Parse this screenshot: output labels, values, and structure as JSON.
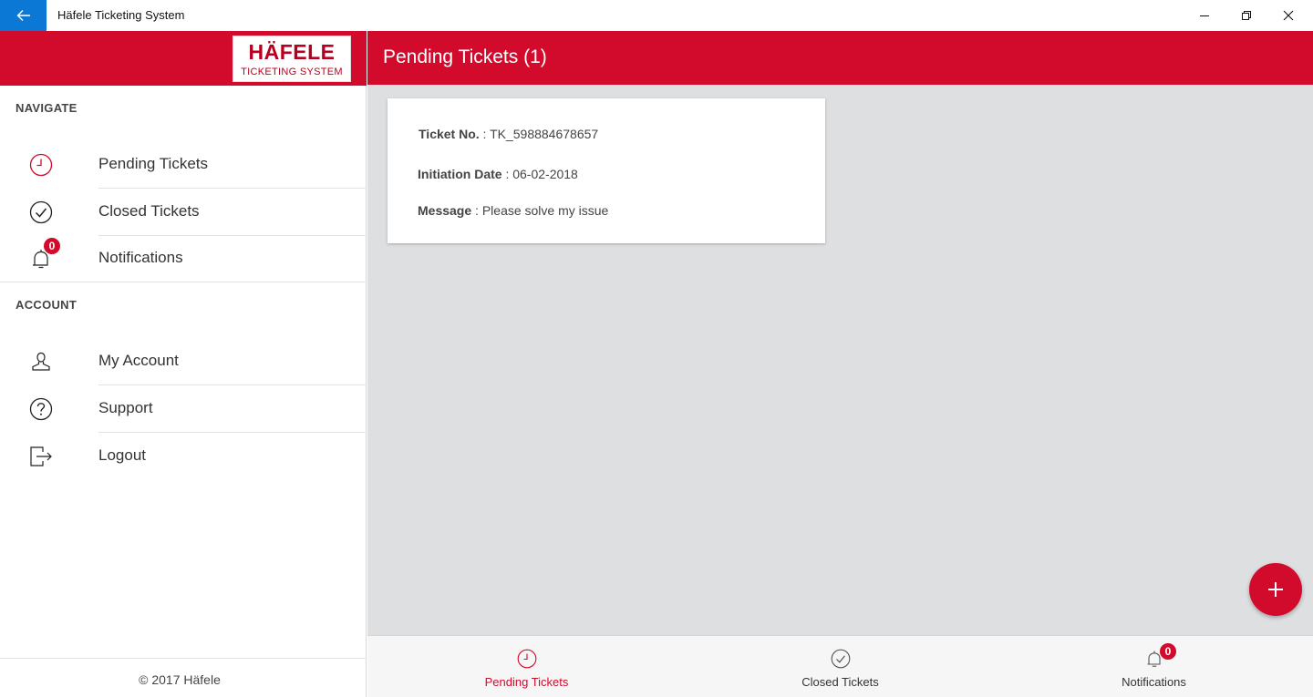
{
  "window": {
    "title": "Häfele Ticketing System"
  },
  "brand": {
    "logo_main": "HÄFELE",
    "logo_sub": "TICKETING SYSTEM",
    "accent_color": "#d20a2c"
  },
  "sidebar": {
    "navigate_heading": "NAVIGATE",
    "navigate_items": [
      {
        "label": "Pending Tickets",
        "icon": "clock-icon",
        "active": true
      },
      {
        "label": "Closed Tickets",
        "icon": "check-circle-icon"
      },
      {
        "label": "Notifications",
        "icon": "bell-icon",
        "badge": "0"
      }
    ],
    "account_heading": "ACCOUNT",
    "account_items": [
      {
        "label": "My Account",
        "icon": "user-icon"
      },
      {
        "label": "Support",
        "icon": "question-circle-icon"
      },
      {
        "label": "Logout",
        "icon": "logout-icon"
      }
    ],
    "copyright": "© 2017 Häfele"
  },
  "main": {
    "title": "Pending Tickets (1)",
    "tickets": [
      {
        "ticket_no_label": "Ticket No.",
        "ticket_no": "TK_598884678657",
        "date_label": "Initiation Date",
        "date": "06-02-2018",
        "message_label": "Message",
        "message": "Please solve my issue"
      }
    ]
  },
  "tabbar": {
    "tabs": [
      {
        "label": "Pending Tickets",
        "icon": "clock-icon",
        "active": true
      },
      {
        "label": "Closed Tickets",
        "icon": "check-circle-icon"
      },
      {
        "label": "Notifications",
        "icon": "bell-icon",
        "badge": "0"
      }
    ]
  }
}
